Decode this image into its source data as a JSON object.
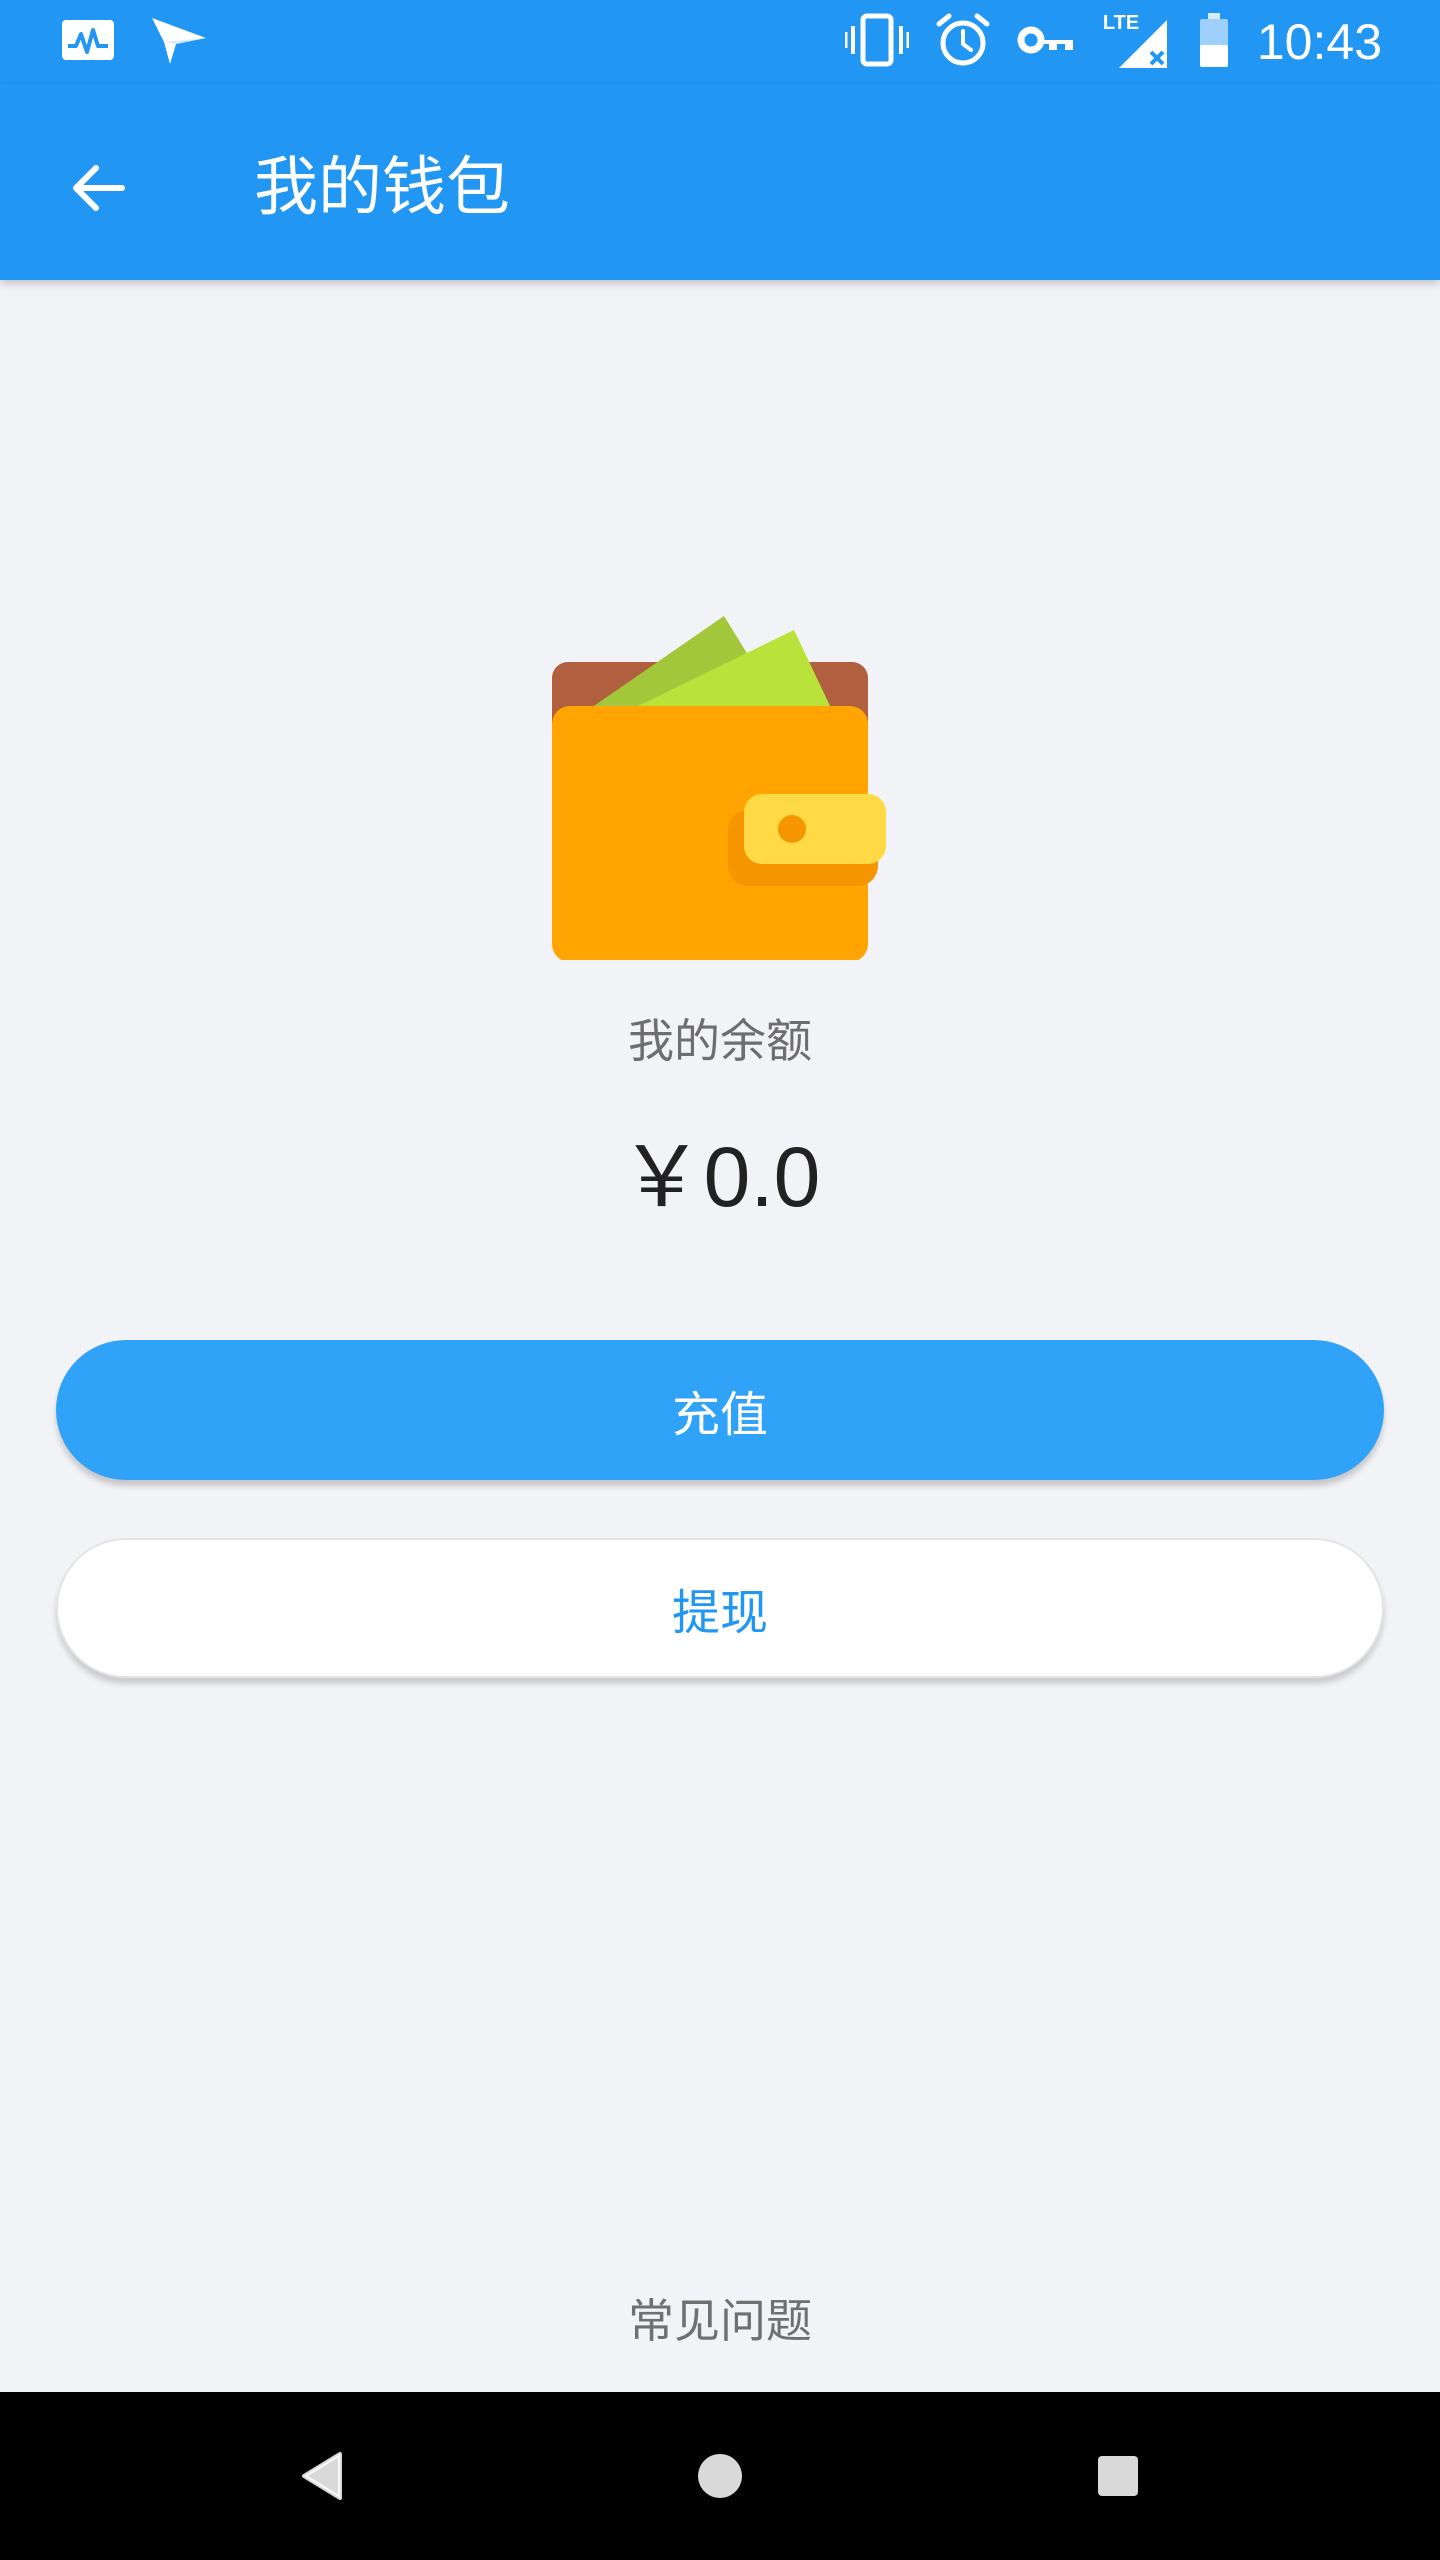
{
  "status_bar": {
    "time": "10:43",
    "network": "LTE",
    "left_icons": [
      "activity-monitor-icon",
      "send-icon"
    ],
    "right_icons": [
      "vibrate-icon",
      "alarm-icon",
      "vpn-key-icon",
      "signal-icon",
      "battery-icon"
    ]
  },
  "app_bar": {
    "title": "我的钱包",
    "back_icon": "arrow-back-icon"
  },
  "wallet": {
    "illustration": "wallet-icon",
    "balance_label": "我的余额",
    "balance_value": "￥0.0"
  },
  "actions": {
    "recharge_label": "充值",
    "withdraw_label": "提现"
  },
  "footer": {
    "faq_label": "常见问题"
  },
  "colors": {
    "primary": "#2196F3",
    "button_primary": "#30A2F8",
    "background": "#F2F3F7",
    "wallet_body": "#FFA400",
    "wallet_back": "#B0603F",
    "wallet_clasp": "#FFDA44"
  },
  "nav_bar": {
    "buttons": [
      "nav-back-icon",
      "nav-home-icon",
      "nav-recent-icon"
    ]
  }
}
